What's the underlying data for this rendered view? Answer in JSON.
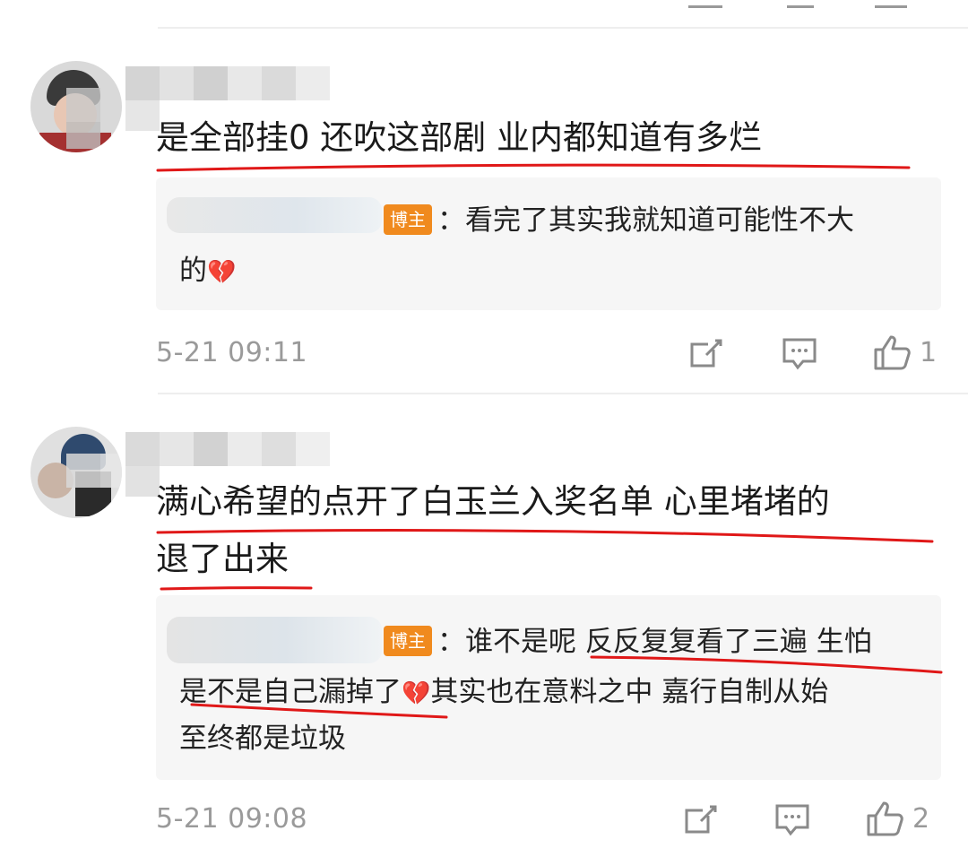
{
  "comments": [
    {
      "text": "是全部挂0  还吹这部剧 业内都知道有多烂",
      "reply": {
        "badge": "博主",
        "line1": "：看完了其实我就知道可能性不大",
        "line2": "的"
      },
      "time": "5-21 09:11",
      "likes": "1"
    },
    {
      "text_line1": "满心希望的点开了白玉兰入奖名单  心里堵堵的",
      "text_line2": "退了出来",
      "reply": {
        "badge": "博主",
        "line1": "：谁不是呢 反反复复看了三遍 生怕",
        "line2a": "是不是自己漏掉了",
        "line2b": "其实也在意料之中 嘉行自制从始",
        "line3": "至终都是垃圾"
      },
      "time": "5-21 09:08",
      "likes": "2"
    }
  ],
  "icons": [
    "share-icon",
    "comment-icon",
    "like-icon",
    "broken-heart-icon"
  ],
  "colors": {
    "badge": "#f08a1e",
    "underline": "#e01818",
    "meta": "#9a9a9a",
    "reply_bg": "#f6f6f6"
  }
}
